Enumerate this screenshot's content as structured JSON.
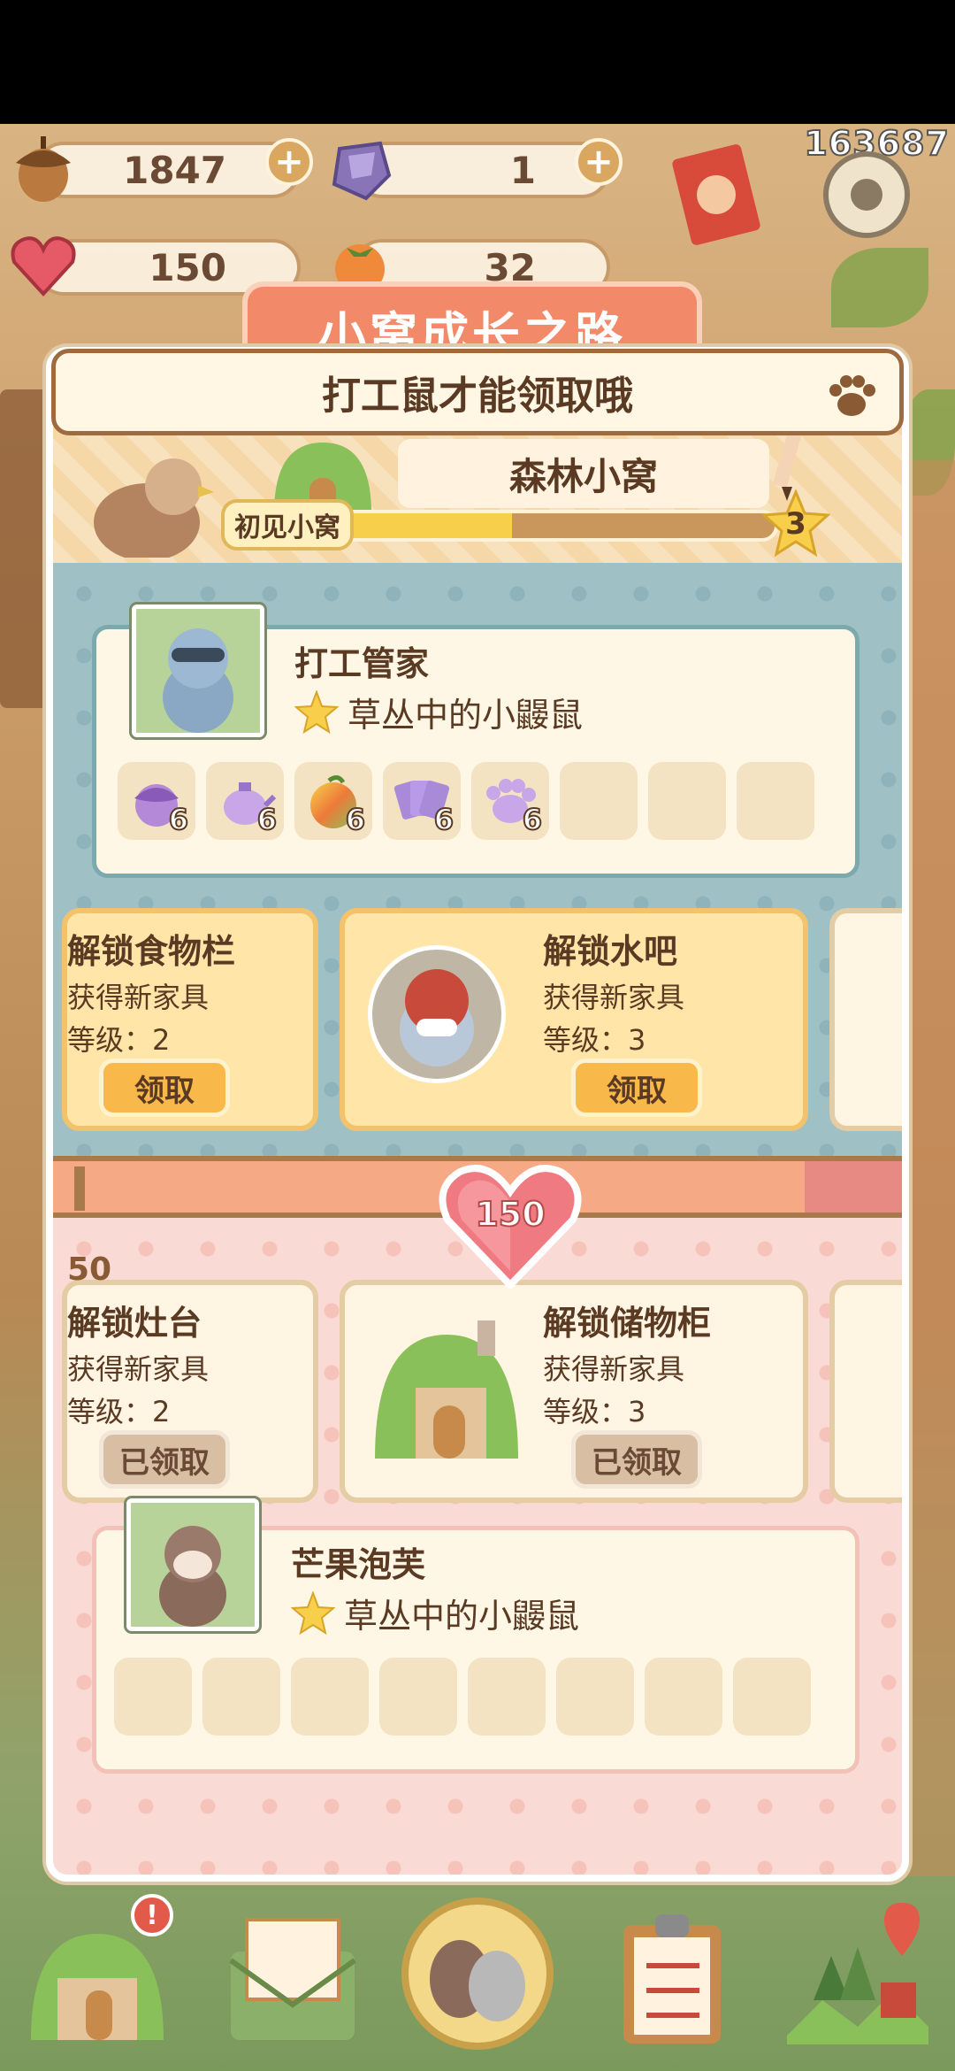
{
  "status": {
    "score": "163687"
  },
  "resources": {
    "acorn": {
      "icon": "acorn-icon",
      "value": "1847"
    },
    "gem": {
      "icon": "purple-gem-icon",
      "value": "1"
    },
    "heart_crystal": {
      "icon": "heart-crystal-icon",
      "value": "150"
    },
    "fruit": {
      "icon": "persimmon-icon",
      "value": "32"
    }
  },
  "panel": {
    "title": "小窝成长之路",
    "toast": "打工鼠才能领取哦",
    "nest_name": "森林小窝",
    "level_label": "初见小窝",
    "level": "3",
    "progress": 0.48
  },
  "blue_section": {
    "character": {
      "name": "打工管家",
      "title": "草丛中的小鼹鼠",
      "items": [
        {
          "icon": "purple-acorn-icon",
          "count": "6"
        },
        {
          "icon": "teapot-icon",
          "count": "6"
        },
        {
          "icon": "rainbow-fruit-icon",
          "count": "6"
        },
        {
          "icon": "cards-icon",
          "count": "6"
        },
        {
          "icon": "paw-icon",
          "count": "6"
        },
        {
          "icon": "empty",
          "count": ""
        },
        {
          "icon": "empty",
          "count": ""
        },
        {
          "icon": "empty",
          "count": ""
        }
      ]
    },
    "rewards": [
      {
        "title": "解锁食物栏",
        "subtitle": "获得新家具",
        "level": "等级：2",
        "button": "领取"
      },
      {
        "title": "解锁水吧",
        "subtitle": "获得新家具",
        "level": "等级：3",
        "button": "领取"
      }
    ]
  },
  "divider": {
    "heart_value": "150",
    "threshold": "50"
  },
  "pink_section": {
    "rewards": [
      {
        "title": "解锁灶台",
        "subtitle": "获得新家具",
        "level": "等级：2",
        "button": "已领取"
      },
      {
        "title": "解锁储物柜",
        "subtitle": "获得新家具",
        "level": "等级：3",
        "button": "已领取"
      }
    ],
    "character": {
      "name": "芒果泡芙",
      "title": "草丛中的小鼹鼠"
    }
  },
  "bottom_nav": [
    {
      "icon": "house-icon",
      "alert": "!"
    },
    {
      "icon": "mail-envelope-icon"
    },
    {
      "icon": "birds-circle-icon"
    },
    {
      "icon": "clipboard-icon"
    },
    {
      "icon": "map-pin-icon"
    }
  ],
  "colors": {
    "accent": "#f28a6a",
    "blue_bg": "#9fc1c6",
    "pink_bg": "#fadad4",
    "gold": "#f8b84a"
  }
}
